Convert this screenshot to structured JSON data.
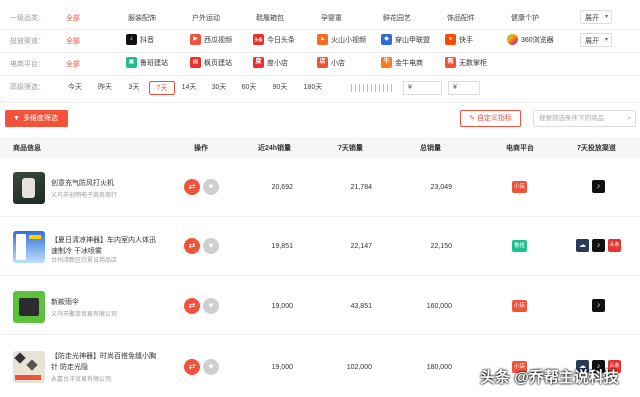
{
  "filters": {
    "category": {
      "label": "一级品类：",
      "options": [
        "全部",
        "服装配饰",
        "户外运动",
        "鞋履箱包",
        "孕婴童",
        "鲜花园艺",
        "饰品配件",
        "健康个护"
      ],
      "active": "全部",
      "expand": "展开"
    },
    "channel": {
      "label": "投放渠道：",
      "all": "全部",
      "options": [
        "抖音",
        "西瓜视频",
        "今日头条",
        "火山小视频",
        "穿山甲联盟",
        "快手",
        "360浏览器"
      ],
      "expand": "展开"
    },
    "platform": {
      "label": "电商平台：",
      "all": "全部",
      "options": [
        "鲁班建站",
        "枫页建站",
        "度小店",
        "小店",
        "金牛电商",
        "无数掌柜"
      ]
    },
    "advanced": {
      "label": "高级筛选：",
      "days": [
        "今天",
        "昨天",
        "3天",
        "7天",
        "14天",
        "30天",
        "60天",
        "90天",
        "180天"
      ],
      "active_day": "7天",
      "price_symbol": "¥"
    }
  },
  "toolbar": {
    "multi_filter": "多维度筛选",
    "custom_metrics": "自定义指标",
    "search_placeholder": "搜索筛选条件下的商品"
  },
  "table": {
    "headers": [
      "商品信息",
      "操作",
      "近24h销量",
      "7天销量",
      "总销量",
      "电商平台",
      "7天投放渠道"
    ],
    "rows": [
      {
        "name": "创意充气防风打火机",
        "shop": "义乌市创明电子商务商行",
        "sales24h": "20,692",
        "sales7d": "21,784",
        "total": "23,049",
        "platform": "小店",
        "channels": [
          "douyin"
        ]
      },
      {
        "name": "【夏日清凉神器】车内室内人体迅速制冷 干冰喷雾",
        "shop": "台州湾新区欣夏日用品店",
        "sales24h": "19,851",
        "sales7d": "22,147",
        "total": "22,150",
        "platform": "鲁班",
        "channels": [
          "cloud",
          "douyin",
          "toutiao"
        ]
      },
      {
        "name": "新款雨伞",
        "shop": "义乌市聚芽贸易有限公司",
        "sales24h": "19,000",
        "sales7d": "43,851",
        "total": "160,000",
        "platform": "小店",
        "channels": [
          "douyin"
        ]
      },
      {
        "name": "【防走光神器】时尚百搭免缝小胸针 防走光隐",
        "shop": "永嘉台洋贸易有限公司",
        "sales24h": "19,000",
        "sales7d": "102,000",
        "total": "180,000",
        "platform": "小店",
        "channels": [
          "cloud",
          "douyin",
          "toutiao"
        ]
      }
    ]
  },
  "channel_labels": {
    "toutiao": "头条"
  },
  "watermark": "头条 @乔帮主说科技",
  "colors": {
    "accent": "#f0523a",
    "luban": "#1fbf8f",
    "xiaodian": "#f0523a"
  }
}
